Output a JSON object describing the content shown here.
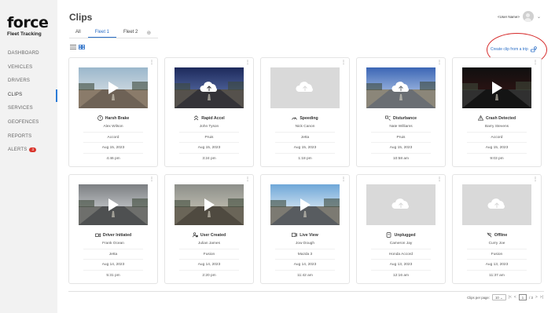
{
  "brand": {
    "name": "force",
    "tagline": "Fleet Tracking"
  },
  "nav": [
    {
      "label": "DASHBOARD",
      "active": false
    },
    {
      "label": "VEHICLES",
      "active": false
    },
    {
      "label": "DRIVERS",
      "active": false
    },
    {
      "label": "CLIPS",
      "active": true
    },
    {
      "label": "SERVICES",
      "active": false
    },
    {
      "label": "GEOFENCES",
      "active": false
    },
    {
      "label": "REPORTS",
      "active": false
    },
    {
      "label": "ALERTS",
      "active": false,
      "badge": "3"
    }
  ],
  "header": {
    "title": "Clips",
    "user_name": "<User Name>"
  },
  "tabs": [
    {
      "label": "All",
      "active": false
    },
    {
      "label": "Fleet 1",
      "active": true
    },
    {
      "label": "Fleet 2",
      "active": false
    }
  ],
  "actions": {
    "create_clip": "Create clip from a trip"
  },
  "colors": {
    "accent": "#2b6fc7",
    "alert": "#d9342b",
    "highlight": "#d62b2b"
  },
  "clips": [
    {
      "event": "Harsh Brake",
      "icon": "alert-circle-icon",
      "driver": "Alex Wilson",
      "vehicle": "Accord",
      "date": "Aug 15, 2023",
      "time": "4:46 pm",
      "thumb": "video",
      "scene": "road-day"
    },
    {
      "event": "Rapid Accel",
      "icon": "rapid-accel-icon",
      "driver": "John Tyson",
      "vehicle": "Pruis",
      "date": "Aug 15, 2023",
      "time": "3:24 pm",
      "thumb": "cloud",
      "scene": "road-dusk"
    },
    {
      "event": "Speeding",
      "icon": "speedometer-icon",
      "driver": "Nick Canon",
      "vehicle": "Jetta",
      "date": "Aug 15, 2023",
      "time": "1:18 pm",
      "thumb": "placeholder",
      "scene": "none"
    },
    {
      "event": "Disturbance",
      "icon": "disturbance-icon",
      "driver": "Nate Williams",
      "vehicle": "Pruis",
      "date": "Aug 15, 2023",
      "time": "10:58 am",
      "thumb": "cloud",
      "scene": "road-blue"
    },
    {
      "event": "Crash Detected",
      "icon": "warning-triangle-icon",
      "driver": "Barry Stevens",
      "vehicle": "Accord",
      "date": "Aug 15, 2023",
      "time": "9:03 pm",
      "thumb": "video",
      "scene": "night"
    },
    {
      "event": "Driver Initiated",
      "icon": "driver-initiated-icon",
      "driver": "Frank Ocean",
      "vehicle": "Jetta",
      "date": "Aug 14, 2023",
      "time": "5:31 pm",
      "thumb": "video",
      "scene": "cloudy"
    },
    {
      "event": "User Created",
      "icon": "user-created-icon",
      "driver": "Julian James",
      "vehicle": "Fusion",
      "date": "Aug 14, 2023",
      "time": "2:20 pm",
      "thumb": "video",
      "scene": "hazy"
    },
    {
      "event": "Live View",
      "icon": "live-view-icon",
      "driver": "Jow Dough",
      "vehicle": "Mazda 3",
      "date": "Aug 14, 2023",
      "time": "11:42 am",
      "thumb": "video",
      "scene": "sky"
    },
    {
      "event": "Unplugged",
      "icon": "unplugged-icon",
      "driver": "Cameron Jay",
      "vehicle": "Honda Accord",
      "date": "Aug 13, 2023",
      "time": "12:16 am",
      "thumb": "cloud-placeholder",
      "scene": "none"
    },
    {
      "event": "Offline",
      "icon": "offline-icon",
      "driver": "Curry Joe",
      "vehicle": "Fusion",
      "date": "Aug 13, 2023",
      "time": "11:37 am",
      "thumb": "cloud-placeholder",
      "scene": "none"
    }
  ],
  "pagination": {
    "per_page_label": "Clips per page:",
    "per_page_value": "10",
    "current_page": "1",
    "total_label": "/ 3"
  }
}
